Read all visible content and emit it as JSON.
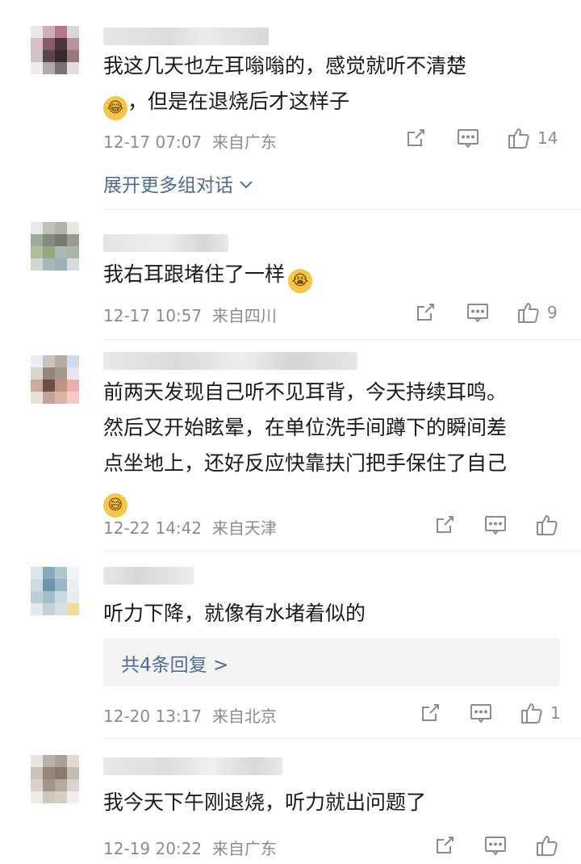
{
  "comments": [
    {
      "lines": [
        "我这几天也左耳嗡嗡的，感觉就听不清楚",
        "，但是在退烧后才这样子"
      ],
      "emoji": "😂",
      "time": "12-17 07:07",
      "location": "来自广东",
      "likes": "14",
      "expand": "展开更多组对话"
    },
    {
      "lines": [
        "我右耳跟堵住了一样"
      ],
      "emoji": "😭",
      "time": "12-17 10:57",
      "location": "来自四川",
      "likes": "9"
    },
    {
      "lines": [
        "前两天发现自己听不见耳背，今天持续耳鸣。",
        "然后又开始眩晕，在单位洗手间蹲下的瞬间差",
        "点坐地上，还好反应快靠扶门把手保住了自己"
      ],
      "emoji": "😅",
      "time": "12-22 14:42",
      "location": "来自天津",
      "likes": ""
    },
    {
      "lines": [
        "听力下降，就像有水堵着似的"
      ],
      "reply": "共4条回复 >",
      "time": "12-20 13:17",
      "location": "来自北京",
      "likes": "1"
    },
    {
      "lines": [
        "我今天下午刚退烧，听力就出问题了"
      ],
      "time": "12-19 20:22",
      "location": "来自广东",
      "likes": ""
    }
  ],
  "colors": {
    "link": "#4d6c96",
    "meta": "#8c8c8c"
  },
  "icons": [
    "repost-icon",
    "comment-icon",
    "like-icon"
  ]
}
